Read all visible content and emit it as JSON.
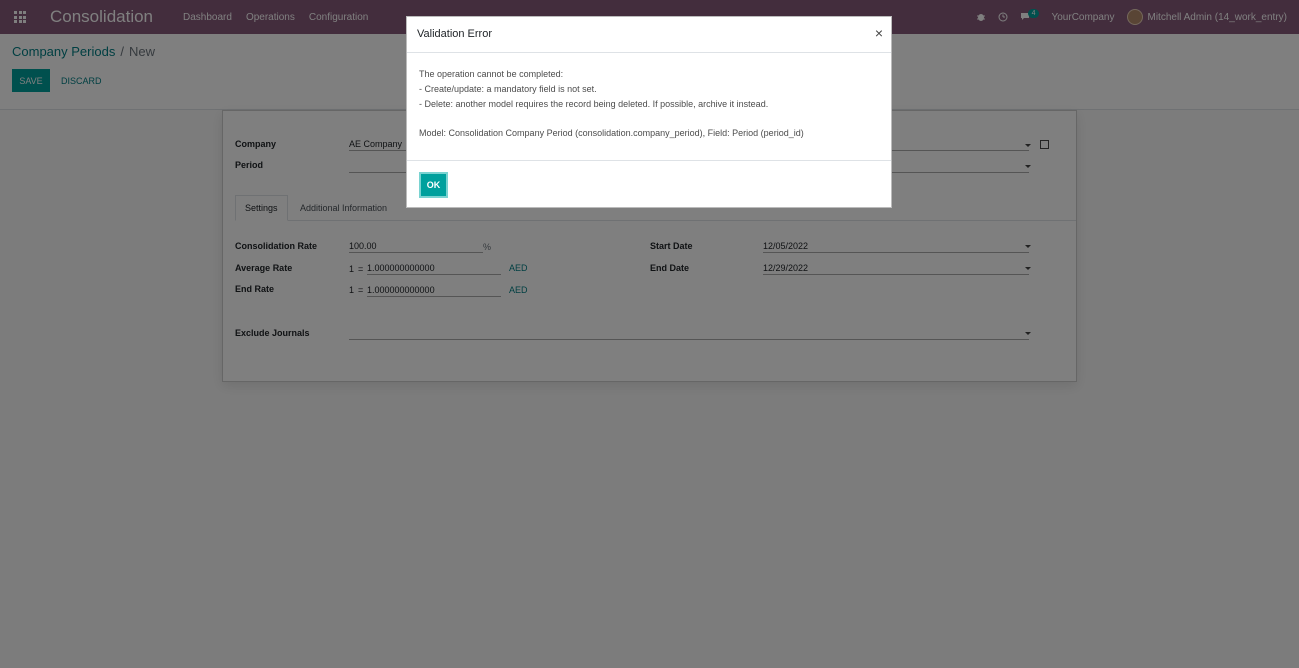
{
  "navbar": {
    "app_title": "Consolidation",
    "menu": [
      "Dashboard",
      "Operations",
      "Configuration"
    ],
    "messages_count": "4",
    "company": "YourCompany",
    "user": "Mitchell Admin (14_work_entry)",
    "bar_color": "#875a7b"
  },
  "breadcrumb": {
    "parent": "Company Periods",
    "separator": "/",
    "current": "New"
  },
  "buttons": {
    "save": "SAVE",
    "discard": "DISCARD"
  },
  "form": {
    "company_label": "Company",
    "company_value": "AE Company",
    "period_label": "Period",
    "period_value": "",
    "tabs": [
      "Settings",
      "Additional Information"
    ],
    "consolidation_rate_label": "Consolidation Rate",
    "consolidation_rate_value": "100.00",
    "percent_sign": "%",
    "average_rate_label": "Average Rate",
    "average_rate_prefix": "1",
    "equals": "=",
    "average_rate_value": "1.000000000000",
    "average_rate_currency": "AED",
    "end_rate_label": "End Rate",
    "end_rate_prefix": "1",
    "end_rate_value": "1.000000000000",
    "end_rate_currency": "AED",
    "start_date_label": "Start Date",
    "start_date_value": "12/05/2022",
    "end_date_label": "End Date",
    "end_date_value": "12/29/2022",
    "exclude_journals_label": "Exclude Journals"
  },
  "dialog": {
    "title": "Validation Error",
    "close": "×",
    "line1": "The operation cannot be completed:",
    "line2": "- Create/update: a mandatory field is not set.",
    "line3": "- Delete: another model requires the record being deleted. If possible, archive it instead.",
    "line4": "Model: Consolidation Company Period (consolidation.company_period), Field: Period (period_id)",
    "ok": "OK"
  },
  "colors": {
    "accent": "#00a09d",
    "link": "#017e84"
  }
}
